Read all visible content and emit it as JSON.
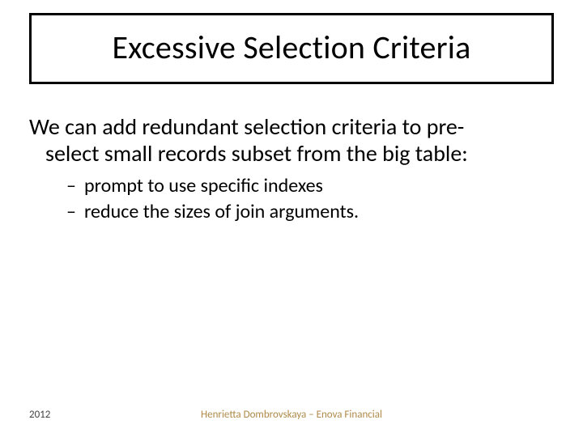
{
  "title": "Excessive Selection Criteria",
  "lead_line1": "We can add redundant selection criteria to pre-",
  "lead_line2": "select small records subset from the big table:",
  "bullets": {
    "b1": " prompt to use specific indexes",
    "b2": "reduce the sizes of join arguments."
  },
  "footer": {
    "year": "2012",
    "attribution": "Henrietta Dombrovskaya – Enova Financial"
  }
}
